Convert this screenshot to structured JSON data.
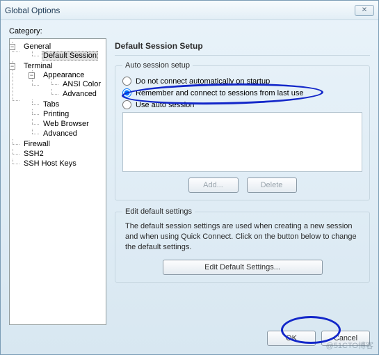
{
  "window": {
    "title": "Global Options"
  },
  "category_label": "Category:",
  "tree": {
    "general": "General",
    "default_session": "Default Session",
    "terminal": "Terminal",
    "appearance": "Appearance",
    "ansi_color": "ANSI Color",
    "advanced_appearance": "Advanced",
    "tabs": "Tabs",
    "printing": "Printing",
    "web_browser": "Web Browser",
    "advanced_terminal": "Advanced",
    "firewall": "Firewall",
    "ssh2": "SSH2",
    "ssh_host_keys": "SSH Host Keys"
  },
  "content": {
    "title": "Default Session Setup",
    "auto_group": "Auto session setup",
    "opt_no_connect": "Do not connect automatically on startup",
    "opt_remember": "Remember and connect to sessions from last use",
    "opt_use_auto": "Use auto session",
    "btn_add": "Add...",
    "btn_delete": "Delete",
    "edit_group": "Edit default settings",
    "edit_desc": "The default session settings are used when creating a new session and when using Quick Connect.  Click on the button below to change the default settings.",
    "btn_edit_defaults": "Edit Default Settings..."
  },
  "footer": {
    "ok": "OK",
    "cancel": "Cancel"
  },
  "watermark": "@51CTO博客"
}
